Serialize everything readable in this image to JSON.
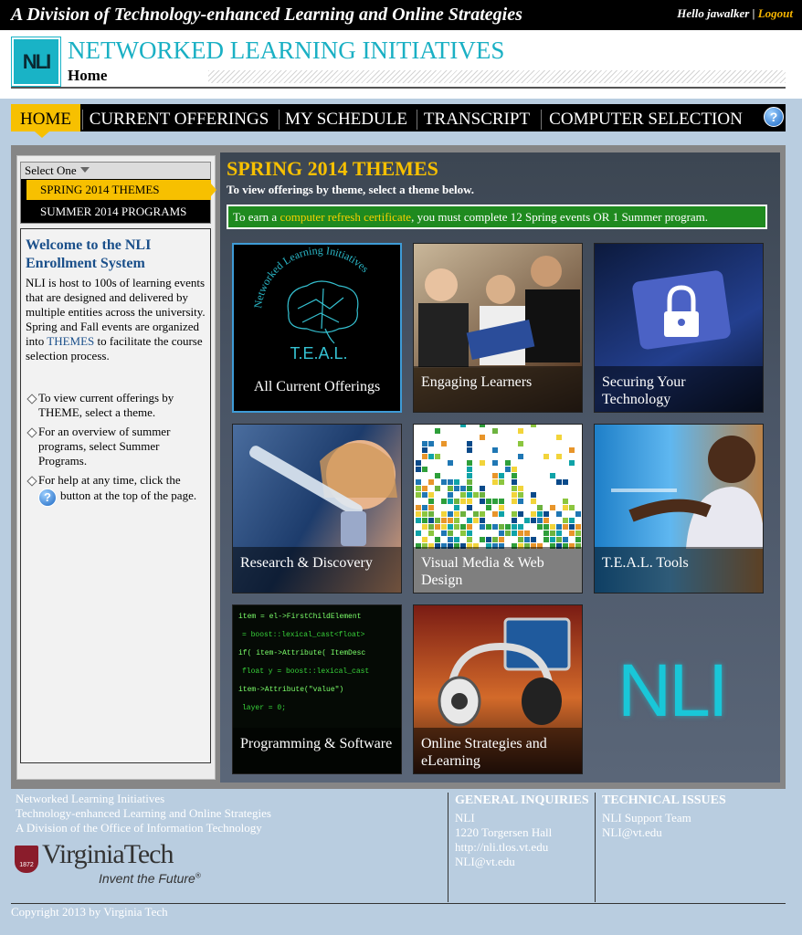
{
  "top_bar": {
    "division": "A Division of Technology-enhanced Learning and Online Strategies",
    "greeting": "Hello jawalker",
    "separator": "|",
    "logout": "Logout"
  },
  "header": {
    "logo_text": "NLI",
    "site_title": "NETWORKED LEARNING INITIATIVES",
    "page": "Home"
  },
  "nav": {
    "items": [
      {
        "label": "HOME",
        "active": true
      },
      {
        "label": "CURRENT OFFERINGS"
      },
      {
        "label": "MY SCHEDULE"
      },
      {
        "label": "TRANSCRIPT"
      },
      {
        "label": "COMPUTER SELECTION"
      }
    ],
    "help_icon": "help-icon",
    "help_glyph": "?"
  },
  "sidebar": {
    "select_label": "Select One",
    "options": [
      "SPRING 2014 THEMES",
      "SUMMER 2014 PROGRAMS"
    ],
    "welcome_title": "Welcome to the NLI Enrollment System",
    "welcome_text_1": "NLI is host to 100s of learning events that are designed and delivered by multiple entities across the university. Spring and Fall events are organized into",
    "welcome_link": "THEMES",
    "welcome_text_2": "to facilitate the course selection process.",
    "bullets": [
      "To view current offerings by THEME, select a theme.",
      "For an overview of summer programs, select Summer Programs.",
      "For help at any time, click the",
      "button at the top of the page."
    ]
  },
  "content": {
    "title": "SPRING 2014 THEMES",
    "subtitle": "To view offerings by theme, select a theme below.",
    "refresh_pre": "To earn a",
    "refresh_link": "computer refresh certificate",
    "refresh_post": ", you must complete 12 Spring events OR 1 Summer program.",
    "teal_arc": "Networked Learning Initiatives",
    "teal_label": "T.E.A.L.",
    "tiles": [
      "All Current Offerings",
      "Engaging Learners",
      "Securing Your Technology",
      "Research & Discovery",
      "Visual Media & Web Design",
      "T.E.A.L. Tools",
      "Programming & Software",
      "Online Strategies and eLearning"
    ],
    "big_logo": "NLI",
    "code_lines": [
      "item = el->FirstChildElement",
      "= boost::lexical_cast<float>",
      "if( item->Attribute( ItemDesc",
      "float y = boost::lexical_cast",
      "item->Attribute(\"value\")",
      "layer = 0;"
    ]
  },
  "footer": {
    "org_lines": [
      "Networked Learning Initiatives",
      "Technology-enhanced Learning and Online Strategies",
      "A Division of the Office of Information Technology"
    ],
    "vt_name": "VirginiaTech",
    "vt_tagline": "Invent the Future",
    "vt_year": "1872",
    "general_heading": "GENERAL INQUIRIES",
    "general_lines": [
      "NLI",
      "1220 Torgersen Hall",
      "http://nli.tlos.vt.edu",
      "NLI@vt.edu"
    ],
    "tech_heading": "TECHNICAL ISSUES",
    "tech_lines": [
      "NLI Support Team",
      "NLI@vt.edu"
    ],
    "copyright": "Copyright 2013 by Virginia Tech"
  }
}
